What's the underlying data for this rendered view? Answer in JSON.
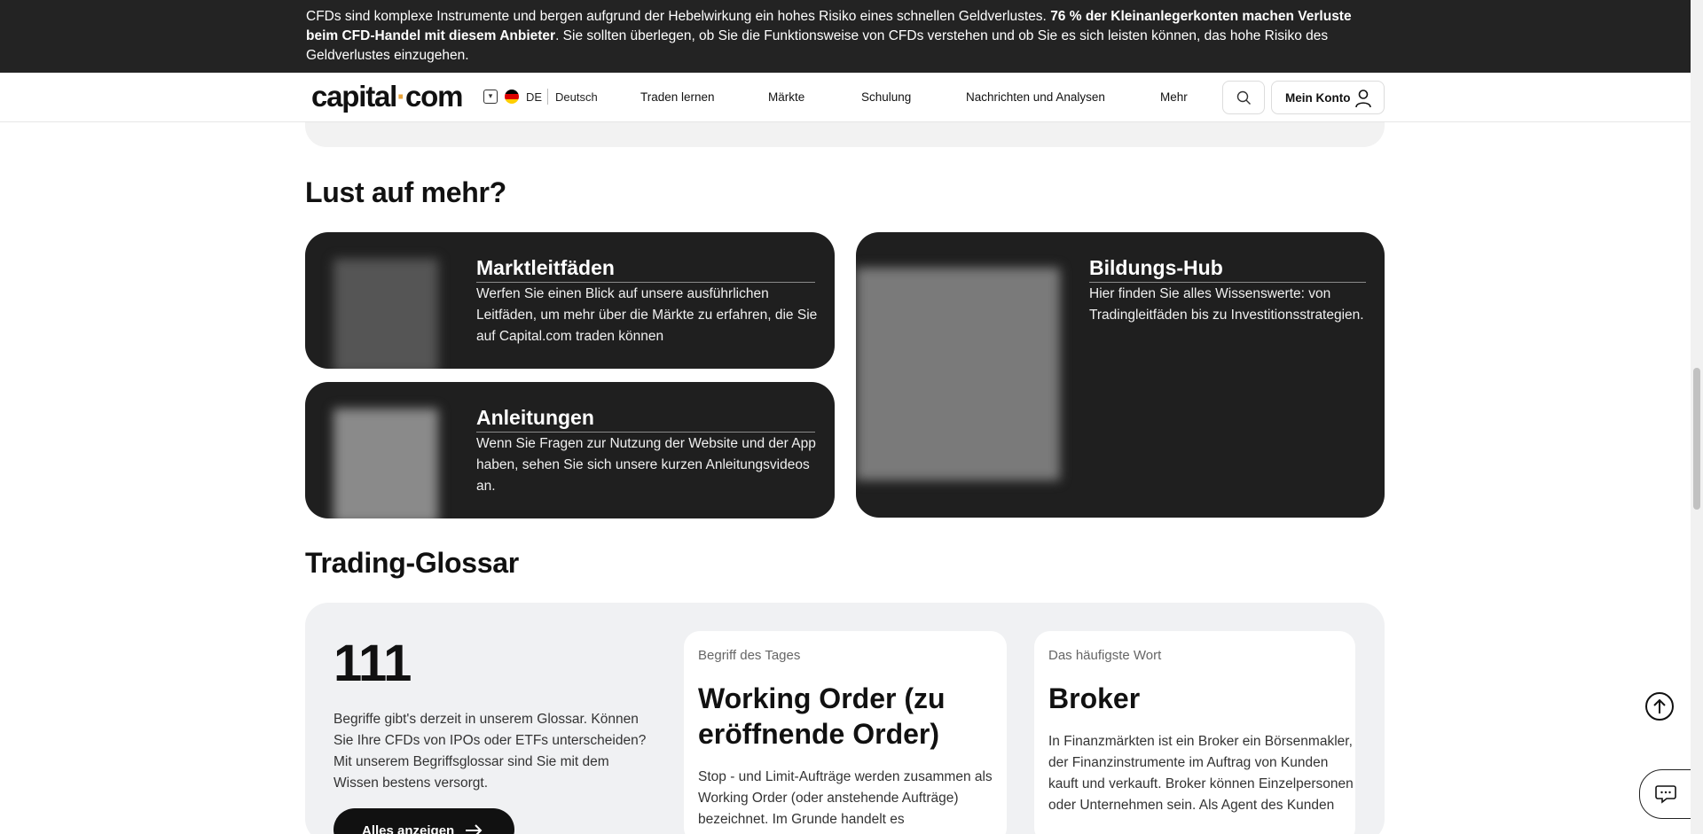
{
  "risk_banner": {
    "text_before": "CFDs sind komplexe Instrumente und bergen aufgrund der Hebelwirkung ein hohes Risiko eines schnellen Geldverlustes. ",
    "text_bold": "76 % der Kleinanlegerkonten machen Verluste beim CFD-Handel mit diesem Anbieter",
    "text_after": ". Sie sollten überlegen, ob Sie die Funktionsweise von CFDs verstehen und ob Sie es sich leisten können, das hohe Risiko des Geldverlustes einzugehen."
  },
  "header": {
    "logo_left": "capital",
    "logo_dot": "·",
    "logo_right": "com",
    "lang_code": "DE",
    "lang_name": "Deutsch",
    "nav": [
      "Traden lernen",
      "Märkte",
      "Schulung",
      "Nachrichten und Analysen",
      "Mehr"
    ],
    "account_label": "Mein Konto"
  },
  "more": {
    "title": "Lust auf mehr?",
    "cards": [
      {
        "title": "Marktleitfäden",
        "desc": "Werfen Sie einen Blick auf unsere ausführlichen Leitfäden, um mehr über die Märkte zu erfahren, die Sie auf Capital.com traden können"
      },
      {
        "title": "Bildungs-Hub",
        "desc": "Hier finden Sie alles Wissenswerte: von Tradingleitfäden bis zu Investitionsstrategien."
      },
      {
        "title": "Anleitungen",
        "desc": "Wenn Sie Fragen zur Nutzung der Website und der App haben, sehen Sie sich unsere kurzen Anleitungsvideos an."
      }
    ]
  },
  "glossar": {
    "title": "Trading-Glossar",
    "count": "111",
    "desc": "Begriffe gibt's derzeit in unserem Glossar. Können Sie Ihre CFDs von IPOs oder ETFs unterscheiden? Mit unserem Begriffsglossar sind Sie mit dem Wissen bestens versorgt.",
    "button_label": "Alles anzeigen",
    "term_of_day": {
      "kicker": "Begriff des Tages",
      "title": "Working Order (zu eröffnende Order)",
      "text": "Stop - und Limit-Aufträge werden zusammen als Working Order (oder anstehende Aufträge) bezeichnet. Im Grunde handelt es"
    },
    "common_word": {
      "kicker": "Das häufigste Wort",
      "title": "Broker",
      "text": "In Finanzmärkten ist ein Broker ein Börsenmakler, der Finanzinstrumente im Auftrag von Kunden kauft und verkauft. Broker können Einzelpersonen oder Unternehmen sein. Als Agent des Kunden"
    }
  },
  "icons": {
    "search": "search-icon",
    "user": "user-icon",
    "arrow_up": "arrow-up-icon",
    "chat": "chat-icon",
    "arrow_right": "arrow-right-icon"
  },
  "colors": {
    "banner_bg": "#232323",
    "card_bg": "#1f1f1f",
    "logo_dot": "#e8a33a",
    "panel_bg": "#f0f1f3"
  }
}
